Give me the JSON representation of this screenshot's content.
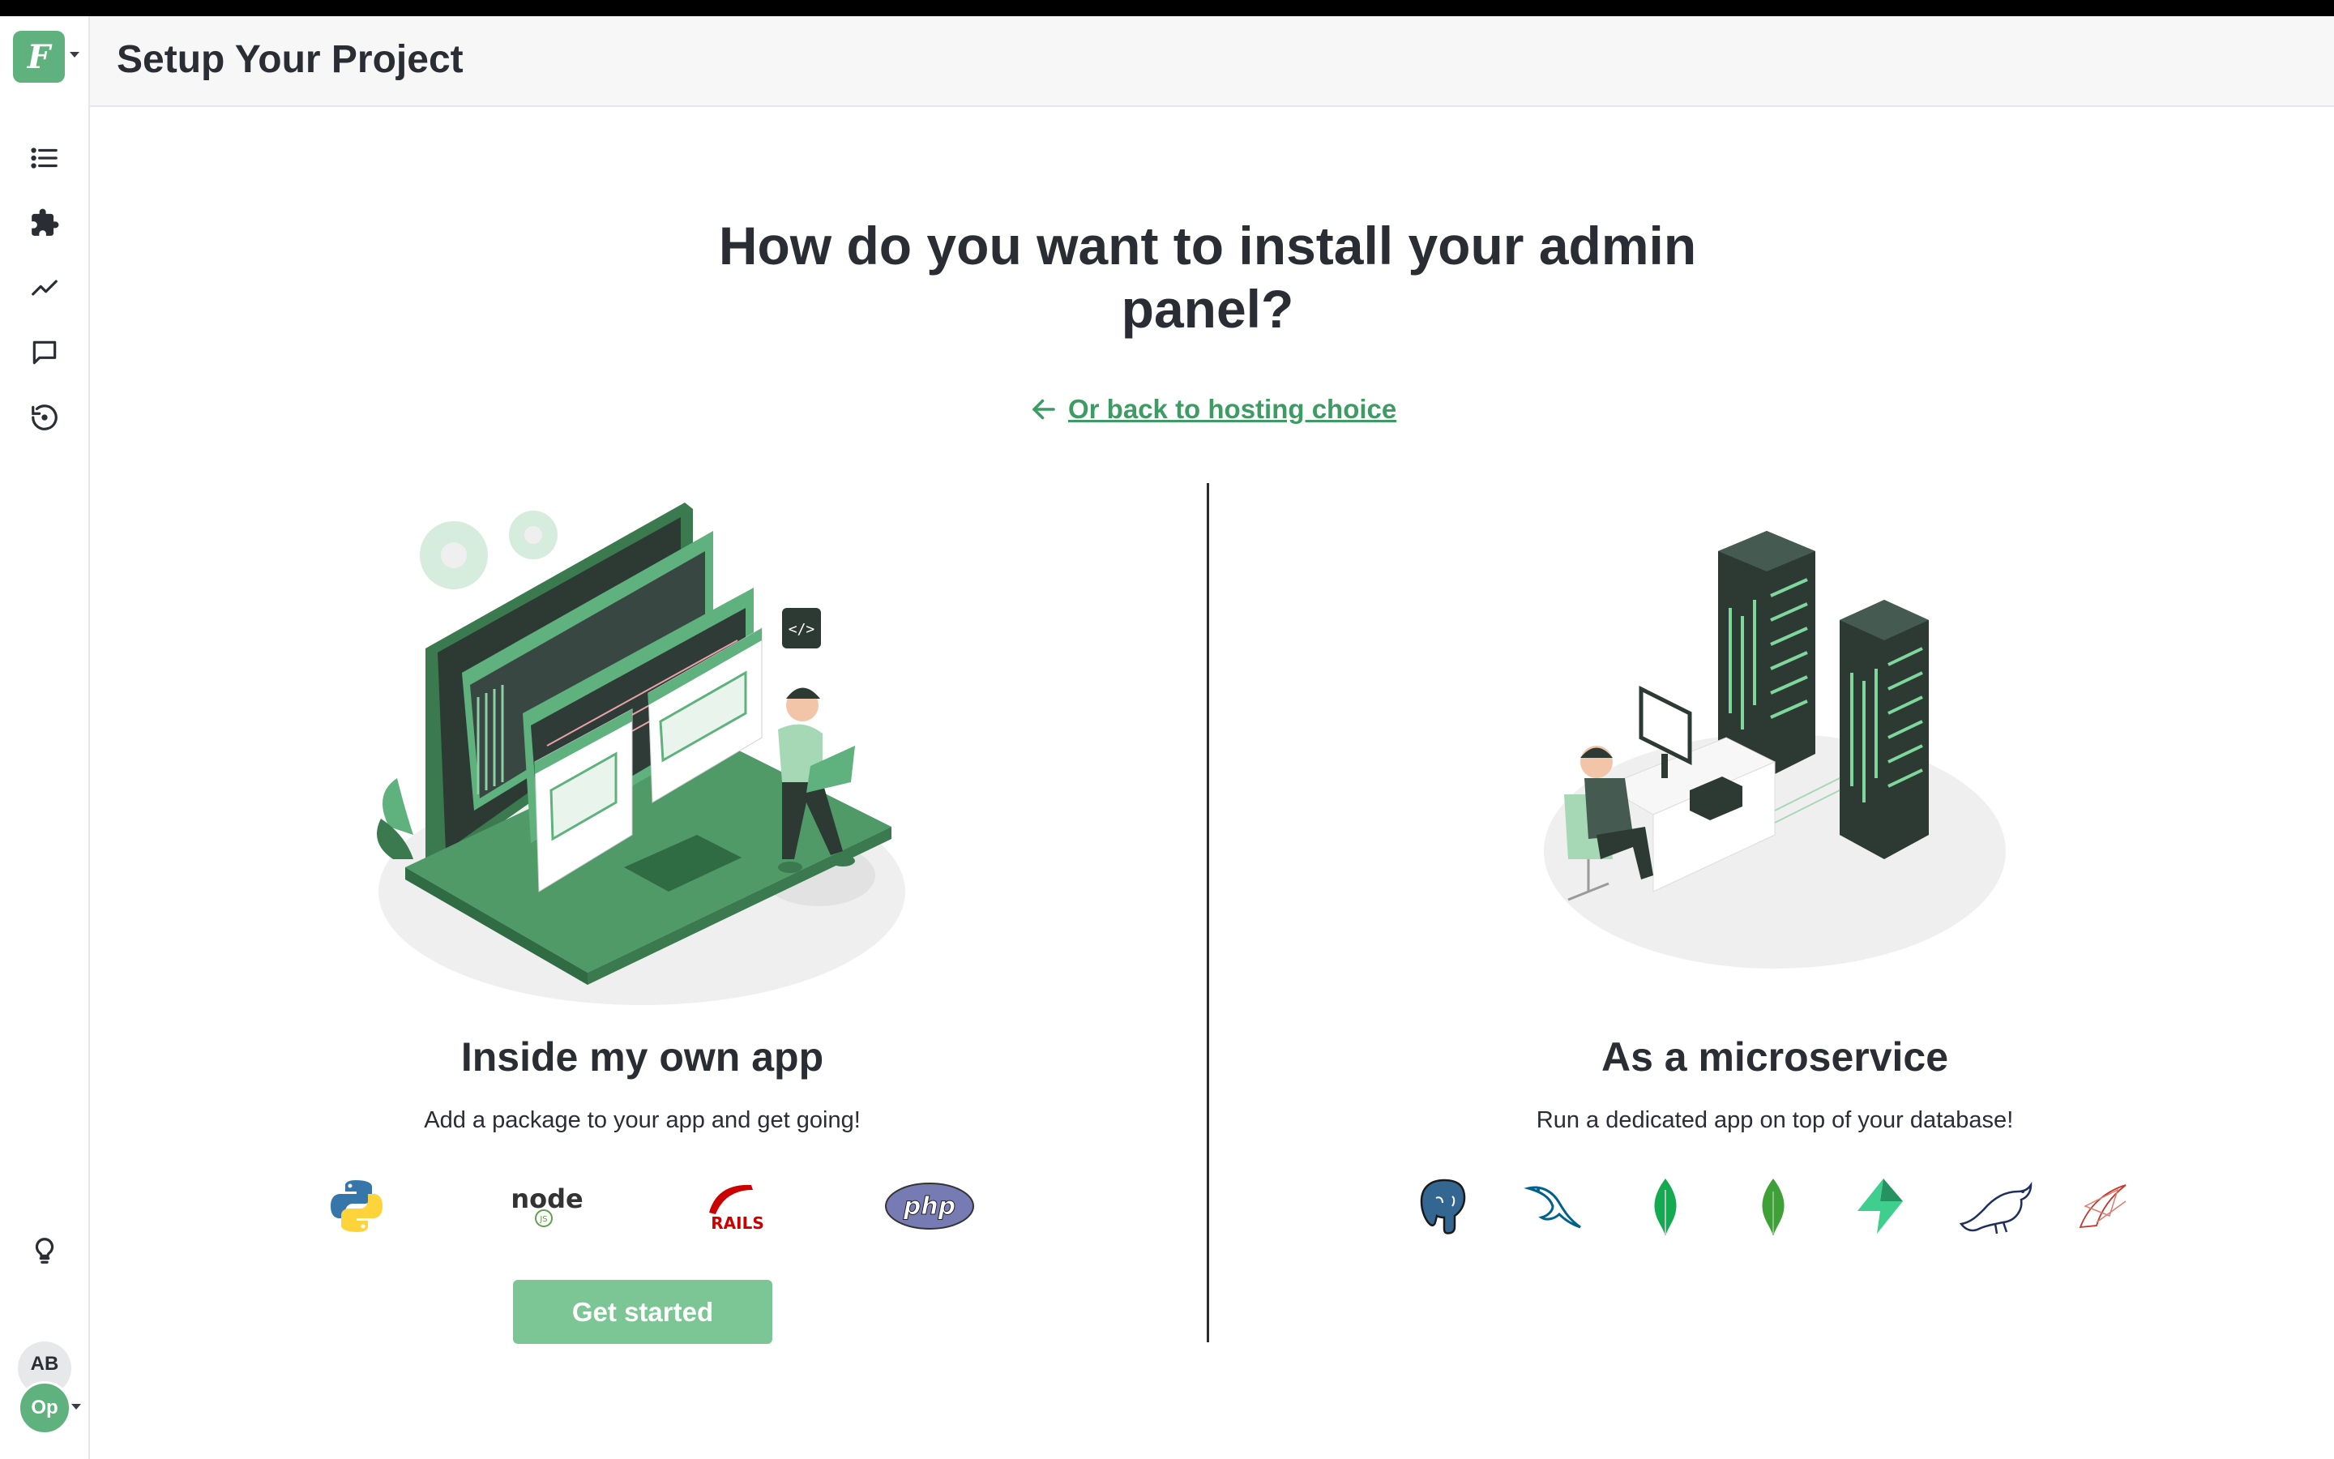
{
  "app": {
    "logo_letter": "F"
  },
  "header": {
    "title": "Setup Your Project"
  },
  "sidebar": {
    "items": [
      {
        "icon": "list-icon"
      },
      {
        "icon": "puzzle-icon"
      },
      {
        "icon": "trend-chart-icon"
      },
      {
        "icon": "chat-icon"
      },
      {
        "icon": "history-icon"
      },
      {
        "icon": "lightbulb-icon"
      }
    ],
    "avatars": {
      "user_initials": "AB",
      "project_initials": "Op"
    }
  },
  "main": {
    "question": "How do you want to install your admin panel?",
    "back_link": "Or back to hosting choice",
    "options": [
      {
        "title": "Inside my own app",
        "description": "Add a package to your app and get going!",
        "logos": [
          "python-logo",
          "nodejs-logo",
          "rails-logo",
          "php-logo"
        ],
        "button": "Get started"
      },
      {
        "title": "As a microservice",
        "description": "Run a dedicated app on top of your database!",
        "logos": [
          "postgresql-logo",
          "mysql-logo",
          "mongodb-logo",
          "mongodb-atlas-logo",
          "supabase-logo",
          "mariadb-logo",
          "sql-server-logo"
        ]
      }
    ],
    "logo_text": {
      "node": "node",
      "node_badge": "JS",
      "rails": "RAILS",
      "php": "php"
    }
  },
  "colors": {
    "brand_green": "#5fb27d",
    "link_green": "#3d9c63",
    "button_green": "#7cc594",
    "text_dark": "#2a2d33"
  }
}
